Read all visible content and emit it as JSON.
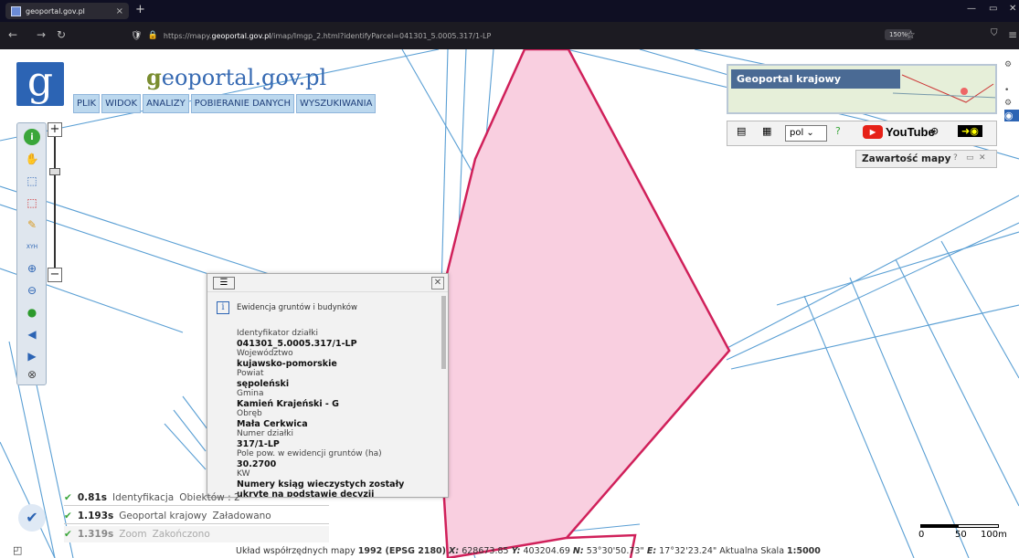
{
  "browser": {
    "tab_title": "geoportal.gov.pl",
    "tab_close": "×",
    "new_tab": "+",
    "url_prefix": "https://mapy.",
    "url_host": "geoportal.gov.pl",
    "url_path": "/imap/Imgp_2.html?identifyParcel=041301_5.0005.317/1-LP",
    "zoom": "150%"
  },
  "site": {
    "name_g": "g",
    "name_rest": "eoportal.gov.pl",
    "logo_letter": "g"
  },
  "menu": [
    "PLIK",
    "WIDOK",
    "ANALIZY",
    "POBIERANIE DANYCH",
    "WYSZUKIWANIA"
  ],
  "overview": {
    "label": "Geoportal krajowy"
  },
  "overview_tools": {
    "language": "pol",
    "youtube": "YouTube"
  },
  "map_contents": {
    "title": "Zawartość mapy",
    "help": "?"
  },
  "popup": {
    "header": "Ewidencja gruntów i budynków",
    "fields": [
      {
        "label": "Identyfikator działki",
        "value": "041301_5.0005.317/1-LP"
      },
      {
        "label": "Województwo",
        "value": "kujawsko-pomorskie"
      },
      {
        "label": "Powiat",
        "value": "sępoleński"
      },
      {
        "label": "Gmina",
        "value": "Kamień Krajeński - G"
      },
      {
        "label": "Obręb",
        "value": "Mała Cerkwica"
      },
      {
        "label": "Numer działki",
        "value": "317/1-LP"
      },
      {
        "label": "Pole pow. w ewidencji gruntów (ha)",
        "value": "30.2700"
      },
      {
        "label": "KW",
        "value": "Numery ksiąg wieczystych zostały ukryte na podstawie decyzji"
      }
    ]
  },
  "status": [
    {
      "time": "0.81s",
      "service": "Identyfikacja",
      "detail": "Obiektów : 2"
    },
    {
      "time": "1.193s",
      "service": "Geoportal krajowy",
      "detail": "Załadowano"
    },
    {
      "time": "1.319s",
      "service": "Zoom",
      "detail": "Zakończono"
    }
  ],
  "footer": {
    "prefix": "Układ współrzędnych mapy",
    "crs": "1992 (EPSG 2180)",
    "x_label": "X:",
    "x": "628673.85",
    "y_label": "Y:",
    "y": "403204.69",
    "n_label": "N:",
    "n": "53°30'50.73\"",
    "e_label": "E:",
    "e": "17°32'23.24\"",
    "scale_label": "Aktualna Skala",
    "scale": "1:5000"
  },
  "scalebar": {
    "t0": "0",
    "t1": "50",
    "t2": "100m"
  },
  "colors": {
    "parcel_fill": "#f9cfe0",
    "parcel_stroke": "#d0205a",
    "lines": "#5a9fd4"
  }
}
